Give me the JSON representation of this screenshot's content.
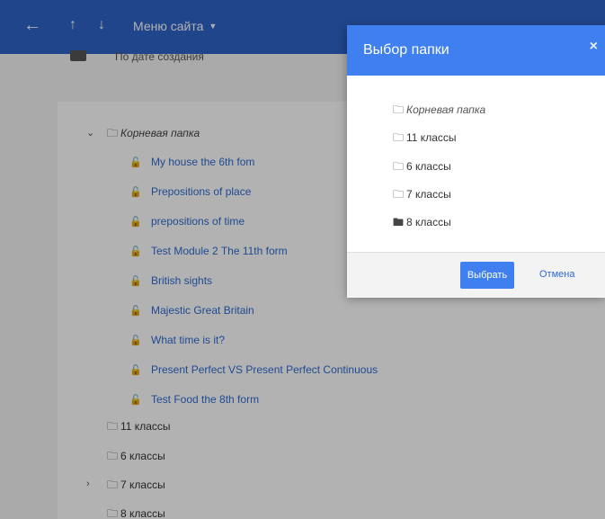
{
  "topbar": {
    "menu_label": "Меню сайта",
    "back_icon": "arrow-left-icon",
    "up_icon": "arrow-up-icon",
    "down_icon": "arrow-down-icon"
  },
  "sort": {
    "label": "По дате создания"
  },
  "tree": {
    "root_label": "Корневая папка",
    "files": [
      "My house the 6th fom",
      "Prepositions of place",
      "prepositions of time",
      "Test Module 2 The 11th form",
      "British sights",
      "Majestic Great Britain",
      "What time is it?",
      "Present Perfect VS Present Perfect Continuous",
      "Test Food the 8th form"
    ],
    "folders": [
      "11 классы",
      "6 классы",
      "7 классы",
      "8 классы"
    ]
  },
  "dialog": {
    "title": "Выбор папки",
    "close": "×",
    "folders": [
      "Корневая папка",
      "11 классы",
      "6 классы",
      "7 классы",
      "8 классы"
    ],
    "selected_index": 4,
    "select_label": "Выбрать",
    "cancel_label": "Отмена"
  },
  "colors": {
    "topbar": "#2e63c7",
    "dialog_header": "#3f7ff0",
    "link": "#2e6bd1",
    "lock": "#3f9c35"
  }
}
